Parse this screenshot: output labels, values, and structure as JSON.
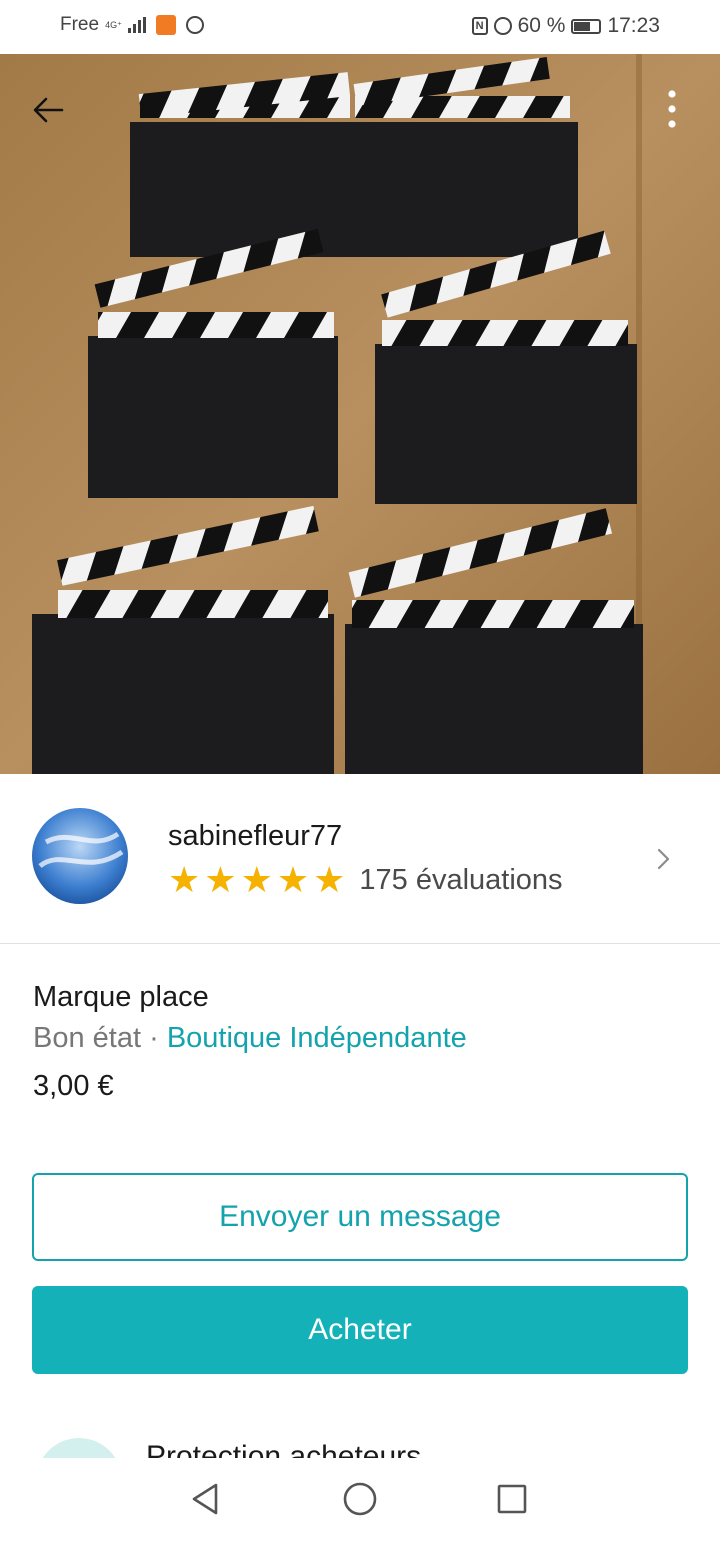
{
  "status_bar": {
    "carrier": "Free",
    "network": "4G⁺",
    "battery": "60 %",
    "time": "17:23"
  },
  "photo": {
    "subject": "clapperboard place cards"
  },
  "icons": {
    "back": "arrow-left-icon",
    "more": "more-vertical-icon",
    "chevron": "chevron-right-icon",
    "star": "star-icon"
  },
  "seller": {
    "name": "sabinefleur77",
    "rating": 5,
    "rating_max": 5,
    "reviews": "175 évaluations"
  },
  "item": {
    "title": "Marque place",
    "condition": "Bon état",
    "separator": " · ",
    "shop": "Boutique Indépendante",
    "price": "3,00 €"
  },
  "actions": {
    "message": "Envoyer un message",
    "buy": "Acheter"
  },
  "protection": {
    "title": "Protection acheteurs"
  },
  "colors": {
    "accent": "#14a3ad",
    "buy_bg": "#14b2b8",
    "star": "#f5b200"
  }
}
